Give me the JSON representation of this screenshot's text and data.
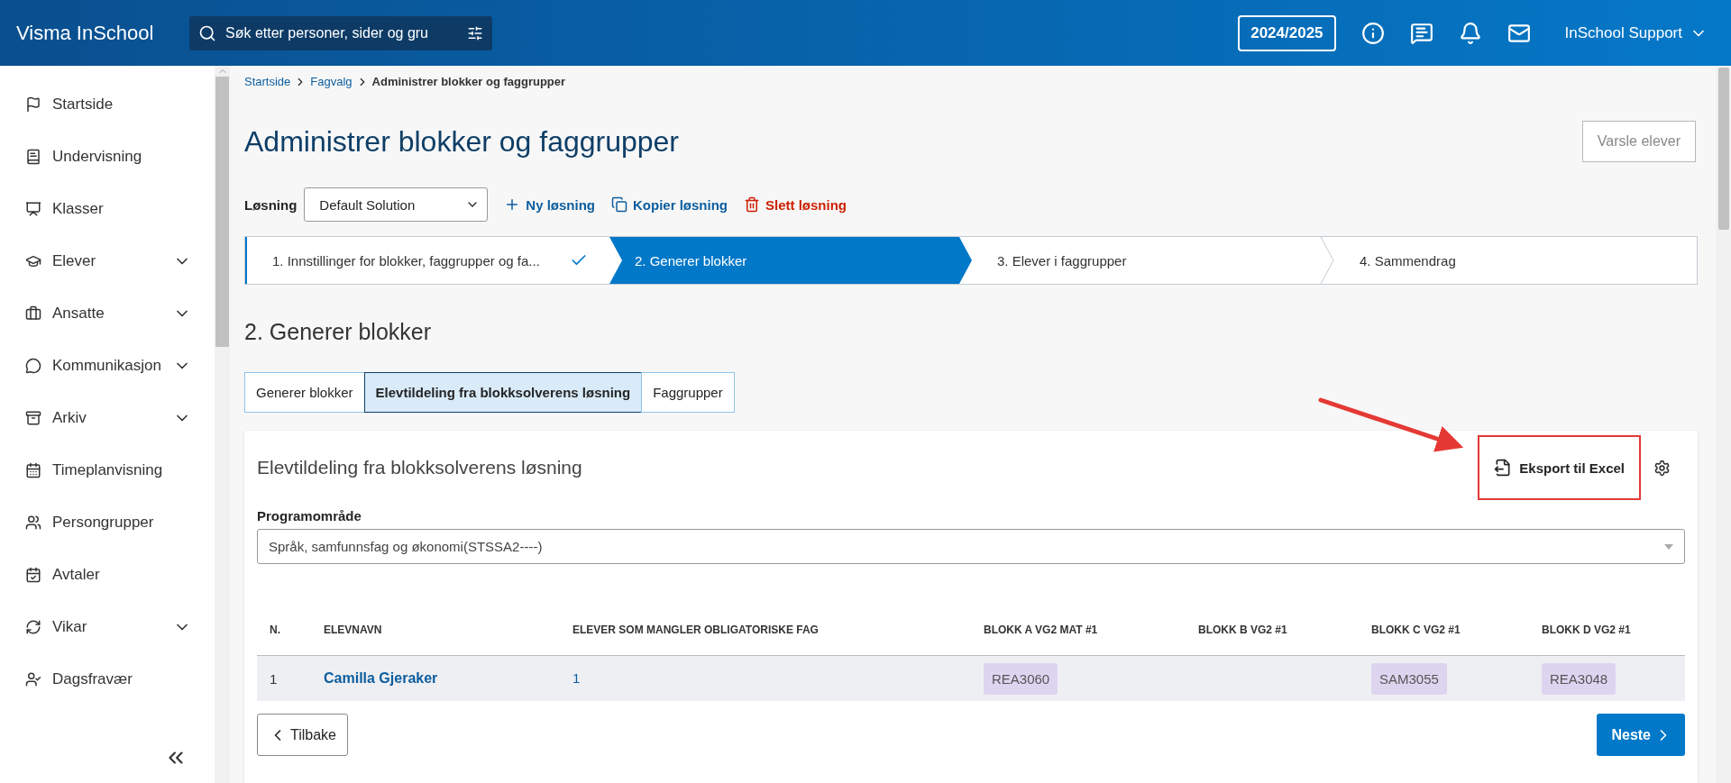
{
  "header": {
    "brand": "Visma InSchool",
    "search": {
      "placeholder": "Søk etter personer, sider og gru"
    },
    "year": "2024/2025",
    "user": "InSchool Support"
  },
  "sidebar": {
    "items": [
      {
        "label": "Startside",
        "expandable": false
      },
      {
        "label": "Undervisning",
        "expandable": false
      },
      {
        "label": "Klasser",
        "expandable": false
      },
      {
        "label": "Elever",
        "expandable": true
      },
      {
        "label": "Ansatte",
        "expandable": true
      },
      {
        "label": "Kommunikasjon",
        "expandable": true
      },
      {
        "label": "Arkiv",
        "expandable": true
      },
      {
        "label": "Timeplanvisning",
        "expandable": false
      },
      {
        "label": "Persongrupper",
        "expandable": false
      },
      {
        "label": "Avtaler",
        "expandable": false
      },
      {
        "label": "Vikar",
        "expandable": true
      },
      {
        "label": "Dagsfravær",
        "expandable": false
      }
    ]
  },
  "breadcrumb": [
    {
      "label": "Startside",
      "link": true
    },
    {
      "label": "Fagvalg",
      "link": true
    },
    {
      "label": "Administrer blokker og faggrupper",
      "link": false
    }
  ],
  "title": "Administrer blokker og faggrupper",
  "notify_button": "Varsle elever",
  "solution": {
    "label": "Løsning",
    "value": "Default Solution",
    "actions": [
      {
        "kind": "add",
        "label": "Ny løsning"
      },
      {
        "kind": "copy",
        "label": "Kopier løsning"
      },
      {
        "kind": "delete",
        "label": "Slett løsning"
      }
    ]
  },
  "steps": [
    {
      "label": "1. Innstillinger for blokker, faggrupper og fa...",
      "completed": true,
      "selected": false
    },
    {
      "label": "2. Generer blokker",
      "completed": false,
      "selected": true
    },
    {
      "label": "3. Elever i faggrupper",
      "completed": false,
      "selected": false
    },
    {
      "label": "4. Sammendrag",
      "completed": false,
      "selected": false
    }
  ],
  "section_title": "2. Generer blokker",
  "tabs": [
    {
      "label": "Generer blokker",
      "selected": false
    },
    {
      "label": "Elevtildeling fra blokksolverens løsning",
      "selected": true
    },
    {
      "label": "Faggrupper",
      "selected": false
    }
  ],
  "card": {
    "title": "Elevtildeling fra blokksolverens løsning",
    "export_button": "Eksport til Excel",
    "program_label": "Programområde",
    "program_value": "Språk, samfunnsfag og økonomi(STSSA2----)",
    "table": {
      "columns": [
        "N.",
        "ELEVNAVN",
        "ELEVER SOM MANGLER OBLIGATORISKE FAG",
        "BLOKK A VG2 MAT #1",
        "BLOKK B VG2 #1",
        "BLOKK C VG2 #1",
        "BLOKK D VG2 #1"
      ],
      "rows": [
        {
          "n": "1",
          "name": "Camilla Gjeraker",
          "missing": "1",
          "block_a": "REA3060",
          "block_c": "SAM3055",
          "block_d": "REA3048"
        }
      ]
    }
  },
  "footer": {
    "back": "Tilbake",
    "next": "Neste"
  }
}
